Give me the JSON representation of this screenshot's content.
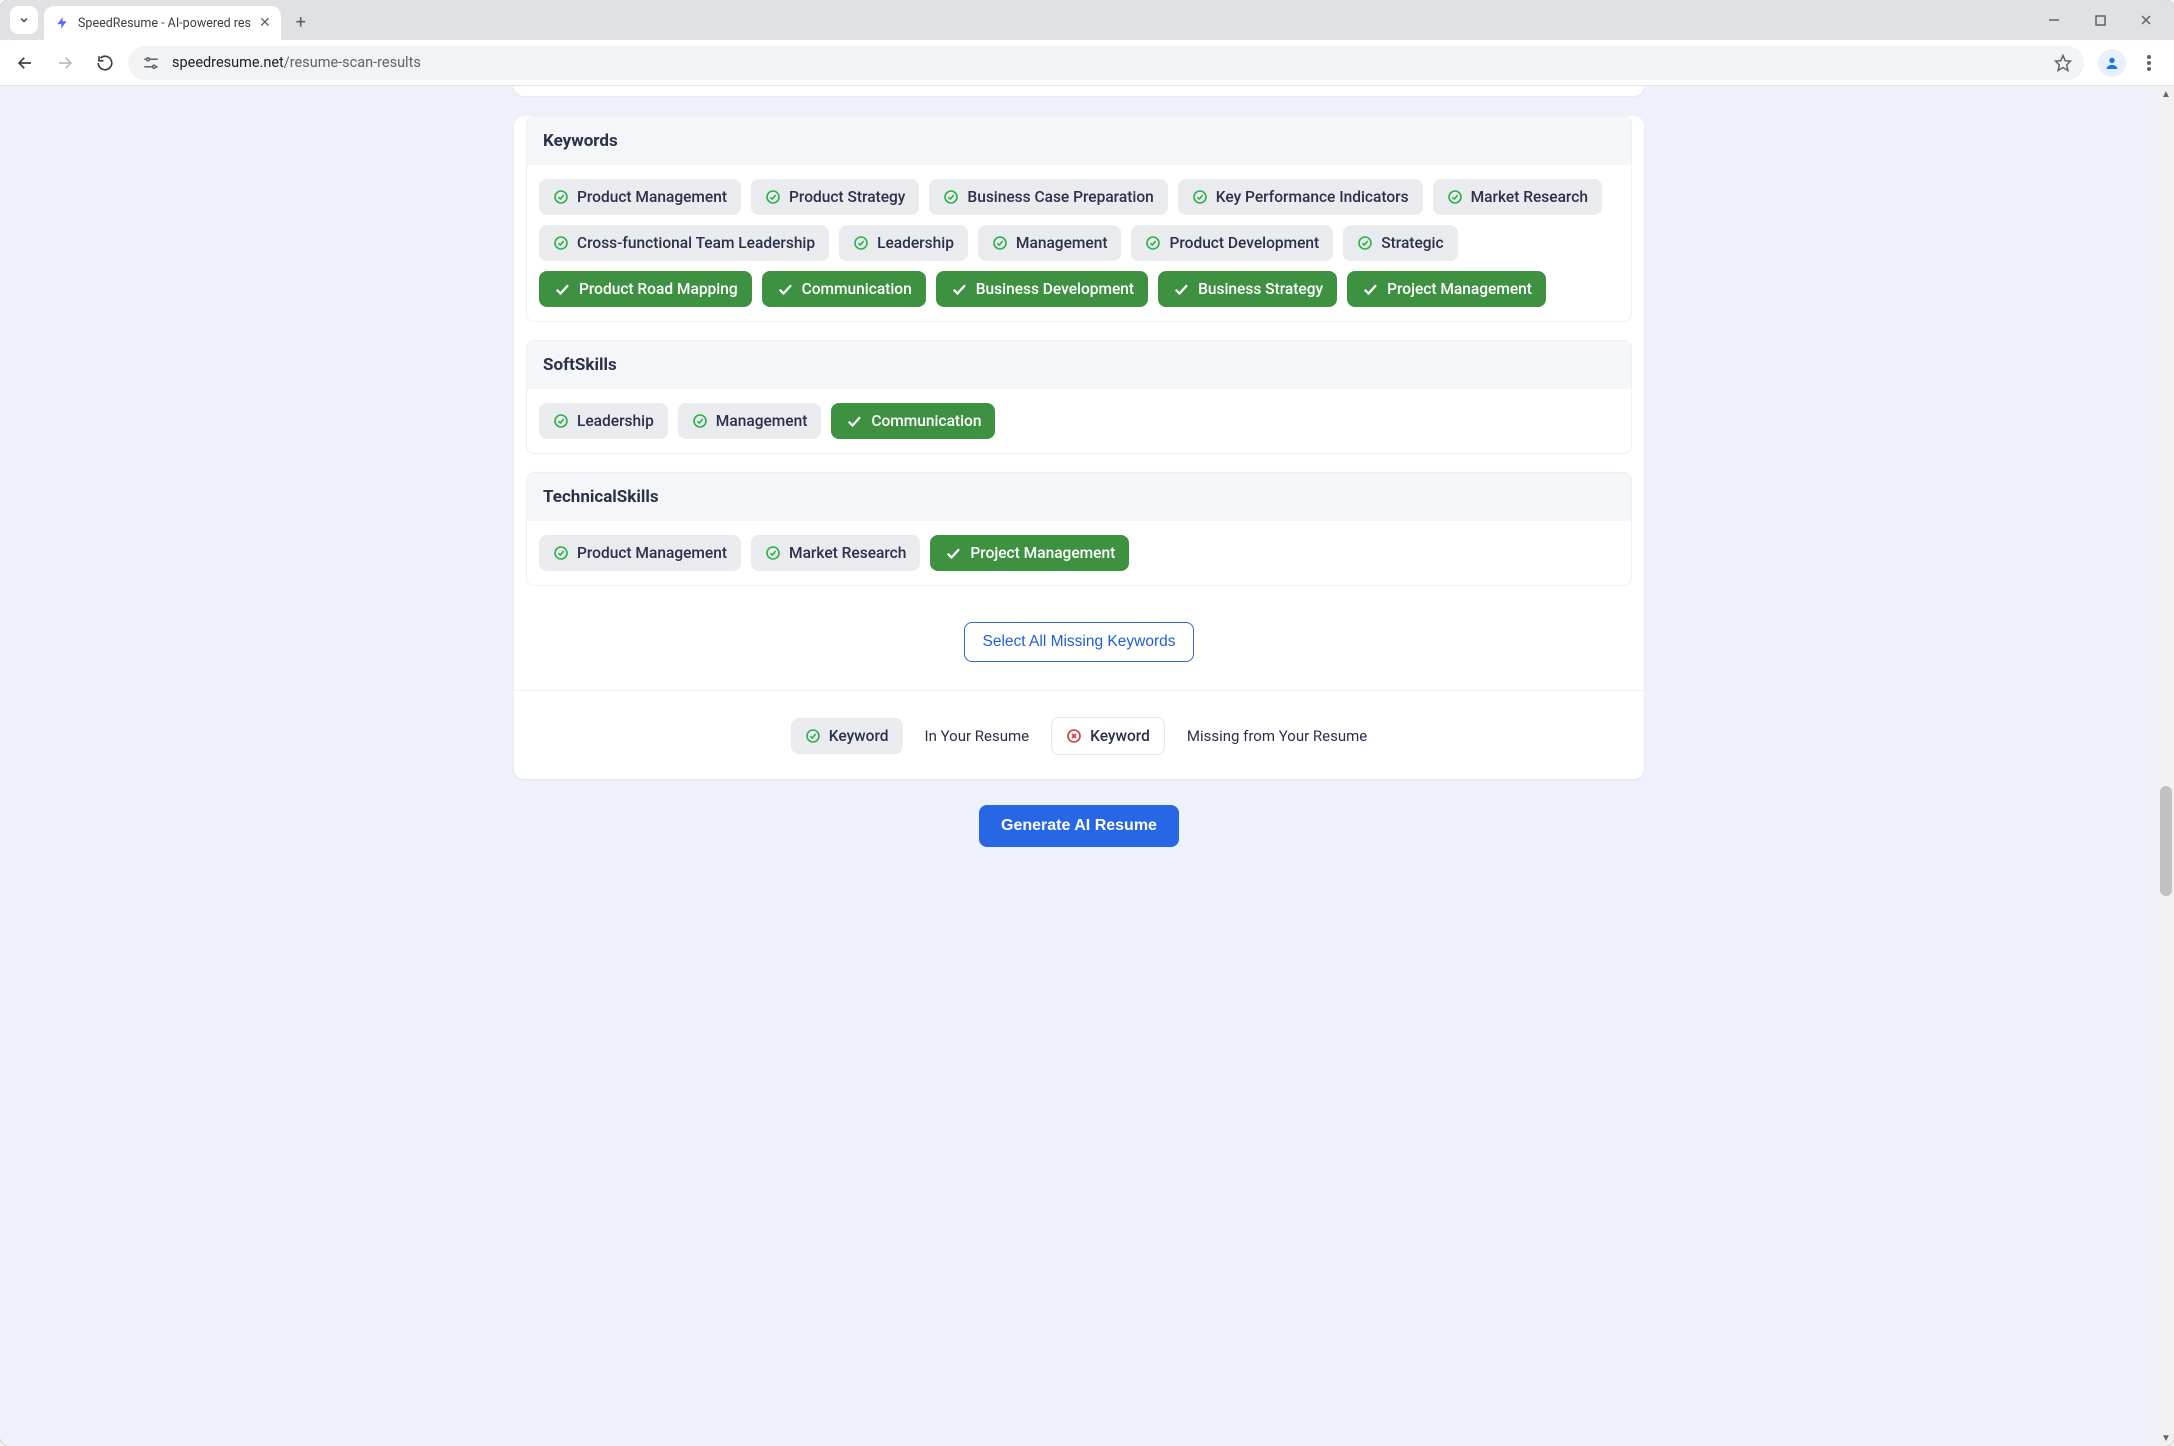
{
  "browser": {
    "tab_title": "SpeedResume - AI-powered res",
    "url_domain": "speedresume.net",
    "url_path": "/resume-scan-results"
  },
  "sections": {
    "keywords_title": "Keywords",
    "softskills_title": "SoftSkills",
    "technicalskills_title": "TechnicalSkills"
  },
  "keywords": [
    {
      "label": "Product Management",
      "state": "present"
    },
    {
      "label": "Product Strategy",
      "state": "present"
    },
    {
      "label": "Business Case Preparation",
      "state": "present"
    },
    {
      "label": "Key Performance Indicators",
      "state": "present"
    },
    {
      "label": "Market Research",
      "state": "present"
    },
    {
      "label": "Cross-functional Team Leadership",
      "state": "present"
    },
    {
      "label": "Leadership",
      "state": "present"
    },
    {
      "label": "Management",
      "state": "present"
    },
    {
      "label": "Product Development",
      "state": "present"
    },
    {
      "label": "Strategic",
      "state": "present"
    },
    {
      "label": "Product Road Mapping",
      "state": "selected"
    },
    {
      "label": "Communication",
      "state": "selected"
    },
    {
      "label": "Business Development",
      "state": "selected"
    },
    {
      "label": "Business Strategy",
      "state": "selected"
    },
    {
      "label": "Project Management",
      "state": "selected"
    }
  ],
  "softskills": [
    {
      "label": "Leadership",
      "state": "present"
    },
    {
      "label": "Management",
      "state": "present"
    },
    {
      "label": "Communication",
      "state": "selected"
    }
  ],
  "technicalskills": [
    {
      "label": "Product Management",
      "state": "present"
    },
    {
      "label": "Market Research",
      "state": "present"
    },
    {
      "label": "Project Management",
      "state": "selected"
    }
  ],
  "actions": {
    "select_all": "Select All Missing Keywords",
    "cta": "Generate AI Resume"
  },
  "legend": {
    "present_chip": "Keyword",
    "present_text": "In Your Resume",
    "missing_chip": "Keyword",
    "missing_text": "Missing from Your Resume"
  }
}
